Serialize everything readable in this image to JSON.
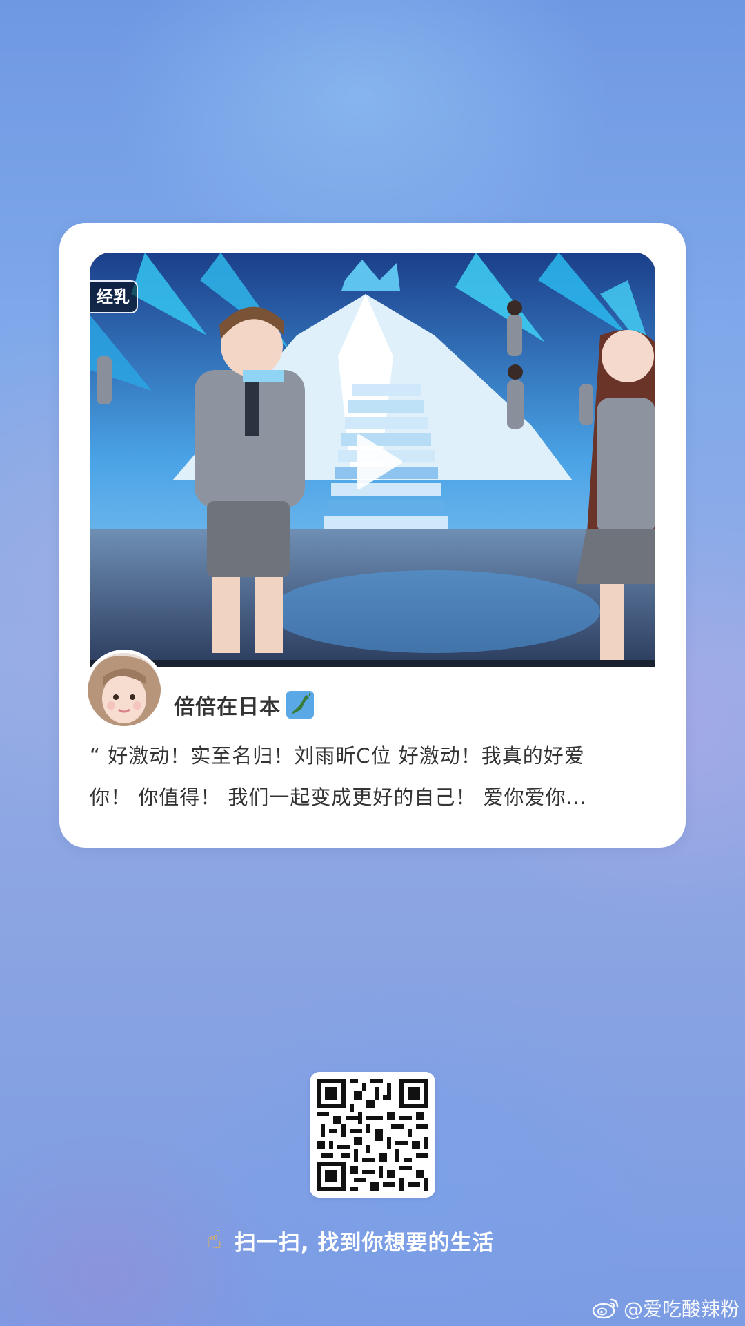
{
  "video": {
    "channel_logo": "经乳",
    "play_icon": "play-icon"
  },
  "post": {
    "author_name": "倍倍在日本",
    "author_badge_icon": "japan-map-icon",
    "text_line_1": "“ 好激动！实至名归！刘雨昕C位 好激动！我真的好爱",
    "text_line_2": "你！ 你值得！ 我们一起变成更好的自己！ 爱你爱你…"
  },
  "footer": {
    "hand_icon": "pointing-hand-icon",
    "scan_text": "扫一扫, 找到你想要的生活",
    "watermark": "@爱吃酸辣粉",
    "watermark_icon": "weibo-icon"
  },
  "colors": {
    "card": "#ffffff",
    "text": "#333333",
    "accent_blue": "#3b8fe0"
  }
}
